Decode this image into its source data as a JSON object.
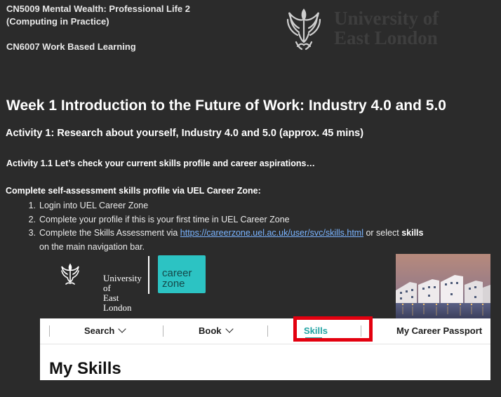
{
  "course": {
    "line1": "CN5009 Mental Wealth: Professional Life 2",
    "line2": "(Computing in Practice)",
    "line3": "CN6007 Work Based Learning"
  },
  "university_logo": {
    "text_line1": "University of",
    "text_line2": "East London",
    "icon": "griffin-crest-icon"
  },
  "week_title": "Week 1 Introduction to the Future of Work: Industry 4.0 and 5.0",
  "activity_title": "Activity 1: Research about yourself, Industry 4.0 and 5.0 (approx. 45 mins)",
  "sub_activity": "Activity 1.1 Let’s check your current skills profile and career aspirations…",
  "instruction": "Complete self-assessment skills profile via UEL Career Zone:",
  "steps": [
    {
      "num": "1.",
      "text": "Login into UEL Career Zone"
    },
    {
      "num": "2.",
      "text": "Complete your profile if this is your first time in UEL Career Zone"
    },
    {
      "num": "3.",
      "text_before": "Complete the Skills Assessment via ",
      "link": "https://careerzone.uel.ac.uk/user/svc/skills.html",
      "text_middle": " or select ",
      "bold": "skills",
      "text_after": "on the main navigation bar."
    }
  ],
  "screenshot": {
    "uel_name_line1": "University of",
    "uel_name_line2": "East London",
    "careerzone_line1": "career",
    "careerzone_line2": "zone",
    "nav": {
      "search": "Search",
      "book": "Book",
      "skills": "Skills",
      "passport": "My Career Passport"
    },
    "heading": "My Skills"
  },
  "colors": {
    "background": "#2b2b2b",
    "link": "#7ab4ff",
    "careerzone_teal": "#2cc3c3",
    "highlight_red": "#e3000f",
    "active_nav": "#1fa3a3"
  }
}
